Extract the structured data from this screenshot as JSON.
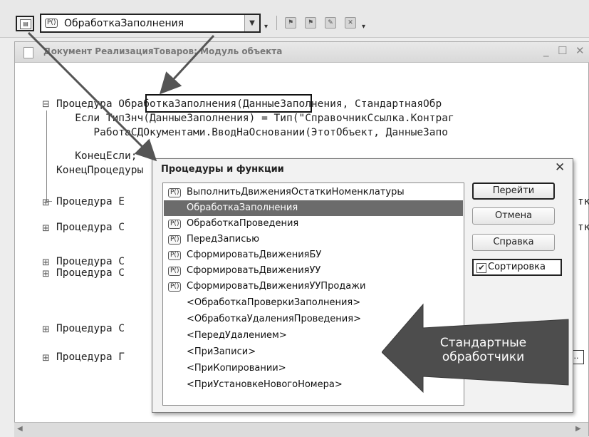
{
  "toolbar": {
    "procedure_badge": "P()",
    "selected_procedure": "ОбработкаЗаполнения"
  },
  "module_window": {
    "title": "Документ РеализацияТоваров: Модуль объекта",
    "code_lines": [
      "Процедура ОбработкаЗаполнения(ДанныеЗаполнения, СтандартнаяОбр",
      "   Если ТипЗнч(ДанныеЗаполнения) = Тип(\"СправочникСсылка.Контраг",
      "      РаботаСДОкументами.ВводНаОсновании(ЭтотОбъект, ДанныеЗапо",
      "   КонецЕсли;",
      "КонецПроцедуры"
    ],
    "collapsed_procedures": [
      {
        "text": "Процедура Е",
        "tail": "тк"
      },
      {
        "text": "Процедура С",
        "tail": "тк"
      },
      {
        "text": "Процедура С",
        "tail": ""
      },
      {
        "text": "Процедура С",
        "tail": ""
      },
      {
        "text": "Процедура С",
        "tail": ""
      },
      {
        "text": "Процедура Г",
        "tail": ".."
      }
    ]
  },
  "dialog": {
    "title": "Процедуры и функции",
    "items": [
      {
        "label": "ВыполнитьДвиженияОстаткиНоменклатуры",
        "badge": "P()"
      },
      {
        "label": "ОбработкаЗаполнения",
        "badge": "",
        "selected": true
      },
      {
        "label": "ОбработкаПроведения",
        "badge": "P()"
      },
      {
        "label": "ПередЗаписью",
        "badge": "P()"
      },
      {
        "label": "СформироватьДвиженияБУ",
        "badge": "P()"
      },
      {
        "label": "СформироватьДвиженияУУ",
        "badge": "P()"
      },
      {
        "label": "СформироватьДвиженияУУПродажи",
        "badge": "P()"
      },
      {
        "label": "<ОбработкаПроверкиЗаполнения>",
        "badge": ""
      },
      {
        "label": "<ОбработкаУдаленияПроведения>",
        "badge": ""
      },
      {
        "label": "<ПередУдалением>",
        "badge": ""
      },
      {
        "label": "<ПриЗаписи>",
        "badge": ""
      },
      {
        "label": "<ПриКопировании>",
        "badge": ""
      },
      {
        "label": "<ПриУстановкеНовогоНомера>",
        "badge": ""
      }
    ],
    "buttons": {
      "goto": "Перейти",
      "cancel": "Отмена",
      "help": "Справка"
    },
    "sort_label": "Сортировка",
    "sort_checked": true
  },
  "callout": {
    "text_line1": "Стандартные",
    "text_line2": "обработчики",
    "color": "#4d4d4d"
  }
}
